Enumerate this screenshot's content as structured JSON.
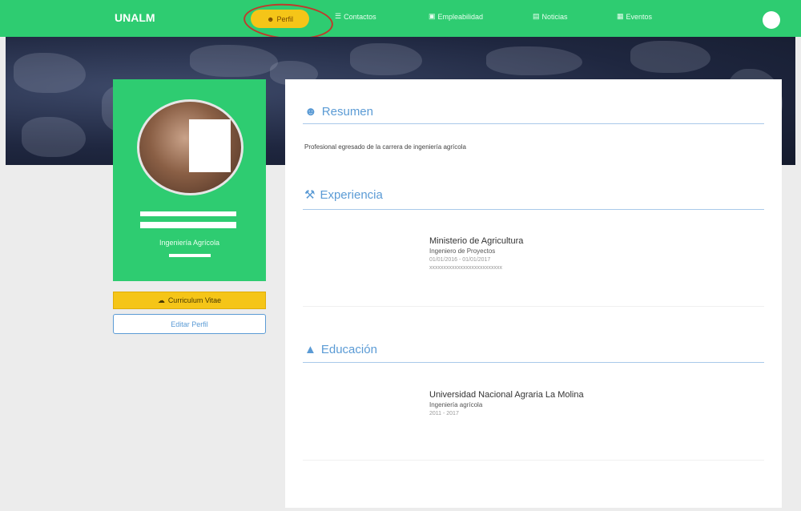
{
  "navbar": {
    "brand": "UNALM",
    "active_item": "Perfil",
    "items": [
      {
        "label": "Contactos",
        "icon": "contacts-icon"
      },
      {
        "label": "Empleabilidad",
        "icon": "briefcase-icon"
      },
      {
        "label": "Noticias",
        "icon": "news-icon"
      },
      {
        "label": "Eventos",
        "icon": "calendar-icon"
      }
    ]
  },
  "profile": {
    "career": "Ingeniería Agrícola",
    "cv_button": "Curriculum Vitae",
    "edit_button": "Editar Perfil"
  },
  "resumen": {
    "title": "Resumen",
    "text": "Profesional egresado de la carrera de ingeniería agrícola"
  },
  "experiencia": {
    "title": "Experiencia",
    "entries": [
      {
        "org": "Ministerio de Agricultura",
        "role": "Ingeniero de Proyectos",
        "dates": "01/01/2016 - 01/01/2017",
        "desc": "xxxxxxxxxxxxxxxxxxxxxxxxxx"
      }
    ]
  },
  "educacion": {
    "title": "Educación",
    "entries": [
      {
        "org": "Universidad Nacional Agraria La Molina",
        "role": "Ingeniería agrícola",
        "dates": "2011 - 2017"
      }
    ]
  },
  "colors": {
    "primary_green": "#2ecc71",
    "accent_yellow": "#f5c518",
    "link_blue": "#5b9bd5"
  }
}
